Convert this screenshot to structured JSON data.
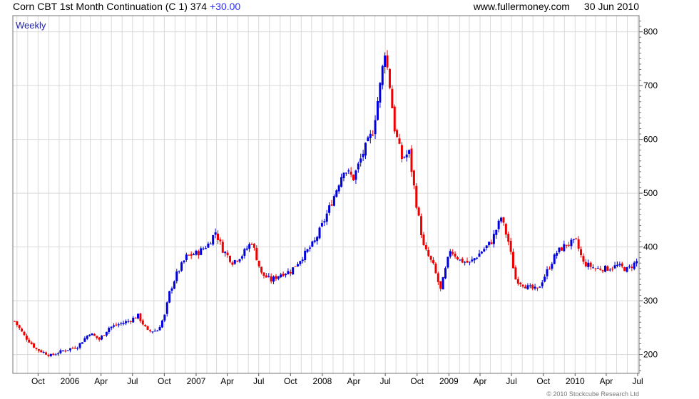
{
  "header": {
    "title": "Corn CBT 1st Month Continuation (C 1) 374",
    "change": "+30.00",
    "site": "www.fullermoney.com",
    "date": "30 Jun 2010"
  },
  "footer": {
    "copyright": "© 2010 Stockcube Research Ltd"
  },
  "colors": {
    "up": "#0000dd",
    "down": "#ee0000",
    "grid": "#d9d9d9",
    "frame": "#777777",
    "period_label": "#2222aa"
  },
  "chart_data": {
    "type": "candlestick",
    "period_label": "Weekly",
    "ylim": [
      165,
      830
    ],
    "y_ticks": [
      200,
      300,
      400,
      500,
      600,
      700,
      800
    ],
    "xlim": [
      "2005-07-20",
      "2010-07-05"
    ],
    "x_ticks": [
      {
        "date": "2005-10-01",
        "label": "Oct"
      },
      {
        "date": "2006-01-01",
        "label": "2006"
      },
      {
        "date": "2006-04-01",
        "label": "Apr"
      },
      {
        "date": "2006-07-01",
        "label": "Jul"
      },
      {
        "date": "2006-10-01",
        "label": "Oct"
      },
      {
        "date": "2007-01-01",
        "label": "2007"
      },
      {
        "date": "2007-04-01",
        "label": "Apr"
      },
      {
        "date": "2007-07-01",
        "label": "Jul"
      },
      {
        "date": "2007-10-01",
        "label": "Oct"
      },
      {
        "date": "2008-01-01",
        "label": "2008"
      },
      {
        "date": "2008-04-01",
        "label": "Apr"
      },
      {
        "date": "2008-07-01",
        "label": "Jul"
      },
      {
        "date": "2008-10-01",
        "label": "Oct"
      },
      {
        "date": "2009-01-01",
        "label": "2009"
      },
      {
        "date": "2009-04-01",
        "label": "Apr"
      },
      {
        "date": "2009-07-01",
        "label": "Jul"
      },
      {
        "date": "2009-10-01",
        "label": "Oct"
      },
      {
        "date": "2010-01-01",
        "label": "2010"
      },
      {
        "date": "2010-04-01",
        "label": "Apr"
      },
      {
        "date": "2010-07-01",
        "label": "Jul"
      }
    ],
    "weekly_close_trend": [
      [
        "2005-07-25",
        262
      ],
      [
        "2005-08-22",
        235
      ],
      [
        "2005-09-26",
        210
      ],
      [
        "2005-11-07",
        198
      ],
      [
        "2005-12-12",
        207
      ],
      [
        "2006-01-23",
        215
      ],
      [
        "2006-02-27",
        240
      ],
      [
        "2006-03-27",
        228
      ],
      [
        "2006-04-24",
        250
      ],
      [
        "2006-05-22",
        256
      ],
      [
        "2006-06-19",
        262
      ],
      [
        "2006-07-17",
        272
      ],
      [
        "2006-08-14",
        243
      ],
      [
        "2006-09-11",
        245
      ],
      [
        "2006-10-02",
        272
      ],
      [
        "2006-10-16",
        315
      ],
      [
        "2006-11-06",
        350
      ],
      [
        "2006-12-04",
        382
      ],
      [
        "2007-01-08",
        390
      ],
      [
        "2007-02-05",
        405
      ],
      [
        "2007-02-26",
        428
      ],
      [
        "2007-03-19",
        395
      ],
      [
        "2007-04-16",
        372
      ],
      [
        "2007-05-14",
        385
      ],
      [
        "2007-06-11",
        410
      ],
      [
        "2007-07-09",
        350
      ],
      [
        "2007-08-06",
        338
      ],
      [
        "2007-09-03",
        350
      ],
      [
        "2007-10-01",
        355
      ],
      [
        "2007-11-05",
        382
      ],
      [
        "2007-12-10",
        410
      ],
      [
        "2008-01-07",
        450
      ],
      [
        "2008-02-04",
        495
      ],
      [
        "2008-03-03",
        545
      ],
      [
        "2008-03-31",
        528
      ],
      [
        "2008-04-28",
        575
      ],
      [
        "2008-05-26",
        615
      ],
      [
        "2008-06-16",
        700
      ],
      [
        "2008-06-30",
        765
      ],
      [
        "2008-07-14",
        700
      ],
      [
        "2008-07-28",
        620
      ],
      [
        "2008-08-18",
        565
      ],
      [
        "2008-09-08",
        575
      ],
      [
        "2008-09-29",
        480
      ],
      [
        "2008-10-20",
        400
      ],
      [
        "2008-11-17",
        365
      ],
      [
        "2008-12-08",
        320
      ],
      [
        "2009-01-05",
        395
      ],
      [
        "2009-02-02",
        375
      ],
      [
        "2009-03-02",
        370
      ],
      [
        "2009-04-06",
        392
      ],
      [
        "2009-05-04",
        410
      ],
      [
        "2009-06-01",
        455
      ],
      [
        "2009-06-22",
        410
      ],
      [
        "2009-07-13",
        340
      ],
      [
        "2009-08-17",
        325
      ],
      [
        "2009-09-14",
        320
      ],
      [
        "2009-10-12",
        355
      ],
      [
        "2009-11-09",
        390
      ],
      [
        "2009-12-07",
        405
      ],
      [
        "2010-01-04",
        410
      ],
      [
        "2010-01-25",
        370
      ],
      [
        "2010-03-01",
        360
      ],
      [
        "2010-04-05",
        360
      ],
      [
        "2010-05-03",
        365
      ],
      [
        "2010-06-01",
        358
      ],
      [
        "2010-06-30",
        374
      ]
    ]
  }
}
